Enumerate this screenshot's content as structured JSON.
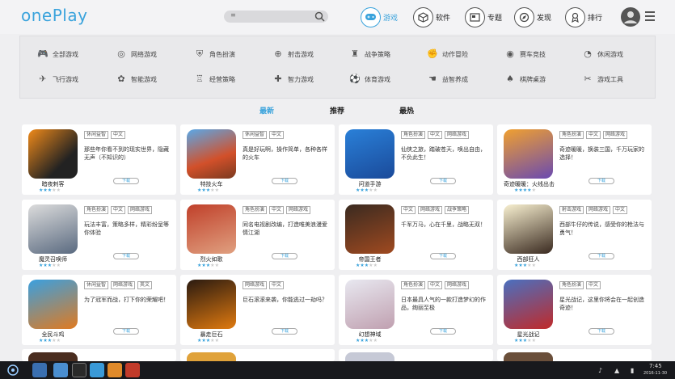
{
  "header": {
    "logo": "onePlay",
    "search_placeholder": "≡",
    "nav": [
      {
        "label": "游戏",
        "icon": "gamepad-icon"
      },
      {
        "label": "软件",
        "icon": "box-icon"
      },
      {
        "label": "专题",
        "icon": "topic-icon"
      },
      {
        "label": "发现",
        "icon": "discover-icon"
      },
      {
        "label": "排行",
        "icon": "rank-icon"
      }
    ]
  },
  "categories": [
    {
      "label": "全部游戏",
      "icon": "gamepad-icon"
    },
    {
      "label": "网络游戏",
      "icon": "globe-icon"
    },
    {
      "label": "角色扮演",
      "icon": "shield-icon"
    },
    {
      "label": "射击游戏",
      "icon": "crosshair-icon"
    },
    {
      "label": "战争策略",
      "icon": "tower-icon"
    },
    {
      "label": "动作冒险",
      "icon": "fist-icon"
    },
    {
      "label": "赛车竞技",
      "icon": "wheel-icon"
    },
    {
      "label": "休闲游戏",
      "icon": "pacman-icon"
    },
    {
      "label": "飞行游戏",
      "icon": "plane-icon"
    },
    {
      "label": "智能游戏",
      "icon": "brain-icon"
    },
    {
      "label": "经营策略",
      "icon": "castle-icon"
    },
    {
      "label": "智力游戏",
      "icon": "puzzle-icon"
    },
    {
      "label": "体育游戏",
      "icon": "ball-icon"
    },
    {
      "label": "益智养成",
      "icon": "hand-icon"
    },
    {
      "label": "棋牌桌游",
      "icon": "cards-icon"
    },
    {
      "label": "游戏工具",
      "icon": "tools-icon"
    }
  ],
  "tabs": [
    {
      "label": "最新",
      "selected": true
    },
    {
      "label": "推荐",
      "selected": false
    },
    {
      "label": "最热",
      "selected": false
    }
  ],
  "games": [
    {
      "name": "暗夜刺客",
      "tags": [
        "休闲益智",
        "中文"
      ],
      "desc": "那些年你看不到的现实世界，隐藏无声（不知识的）",
      "stars": 3,
      "download": "下载"
    },
    {
      "name": "特技火车",
      "tags": [
        "休闲益智",
        "中文"
      ],
      "desc": "真是好玩啊，操作简单，各种各样的火车",
      "stars": 3,
      "download": "下载"
    },
    {
      "name": "问道手游",
      "tags": [
        "角色扮演",
        "中文",
        "网络游戏"
      ],
      "desc": "仙侠之旅，踏破苍天，唤出自由，不负此生！",
      "stars": 3,
      "download": "下载"
    },
    {
      "name": "奇迹暖暖：火线出击",
      "tags": [
        "角色扮演",
        "中文",
        "网络游戏"
      ],
      "desc": "奇迹暖暖，换装三国，千万玩家的选择！",
      "stars": 4,
      "download": "下载"
    },
    {
      "name": "魔灵召唤师",
      "tags": [
        "角色扮演",
        "中文",
        "网络游戏"
      ],
      "desc": "玩法丰富，策略多样，精彩纷呈等你体验",
      "stars": 3,
      "download": "下载"
    },
    {
      "name": "烈火如歌",
      "tags": [
        "角色扮演",
        "中文",
        "网络游戏"
      ],
      "desc": "同名电视剧改编，打造唯美浪漫爱情江湖",
      "stars": 3,
      "download": "下载"
    },
    {
      "name": "帝国王者",
      "tags": [
        "中文",
        "网络游戏",
        "战争策略"
      ],
      "desc": "千军万马，心在千里，战略无双！",
      "stars": 3,
      "download": "下载"
    },
    {
      "name": "西部狂人",
      "tags": [
        "射击游戏",
        "网络游戏",
        "中文"
      ],
      "desc": "西部牛仔的传说，感受你的枪法与勇气！",
      "stars": 3,
      "download": "下载"
    },
    {
      "name": "全民斗鸡",
      "tags": [
        "休闲益智",
        "网络游戏",
        "英文"
      ],
      "desc": "为了冠军而战，打下你的荣耀吧！",
      "stars": 3,
      "download": "下载"
    },
    {
      "name": "暴走巨石",
      "tags": [
        "网络游戏",
        "中文"
      ],
      "desc": "巨石滚滚来袭，你能逃过一劫吗？",
      "stars": 3,
      "download": "下载"
    },
    {
      "name": "幻想神域",
      "tags": [
        "角色扮演",
        "中文",
        "网络游戏"
      ],
      "desc": "日本最具人气的一款打造梦幻的作品，绚丽至极",
      "stars": 3,
      "download": "下载"
    },
    {
      "name": "星光战记",
      "tags": [
        "角色扮演",
        "中文"
      ],
      "desc": "星光战记，这里你将会在一起创造奇迹！",
      "stars": 3,
      "download": "下载"
    }
  ],
  "taskbar": {
    "time": "7:45",
    "date": "2016-11-30"
  },
  "colors": {
    "accent": "#3aa3dc",
    "taskbar": "#18191d"
  }
}
